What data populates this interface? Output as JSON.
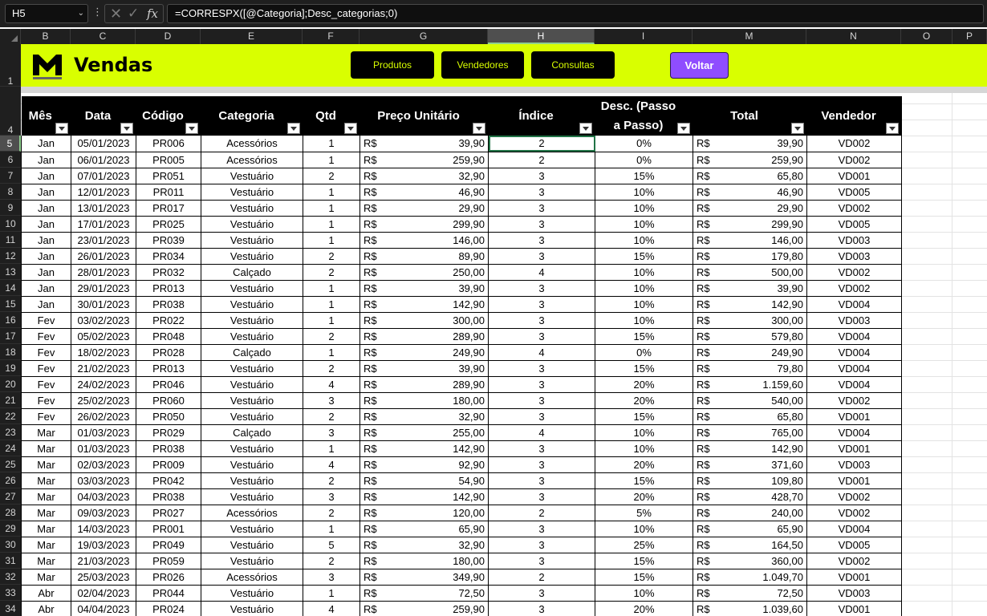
{
  "formula_bar": {
    "name_box": "H5",
    "cancel_icon": "close-icon",
    "enter_icon": "check-icon",
    "fx_label": "fx",
    "formula": "=CORRESPX([@Categoria];Desc_categorias;0)"
  },
  "columns": [
    "B",
    "C",
    "D",
    "E",
    "F",
    "G",
    "H",
    "I",
    "M",
    "N",
    "O",
    "P"
  ],
  "active_column": "H",
  "row_numbers": [
    "1",
    "4",
    "5",
    "6",
    "7",
    "8",
    "9",
    "10",
    "11",
    "12",
    "13",
    "14",
    "15",
    "16",
    "17",
    "18",
    "19",
    "20",
    "21",
    "22",
    "23",
    "24",
    "25",
    "26",
    "27",
    "28",
    "29",
    "30",
    "31",
    "32",
    "33",
    "34"
  ],
  "active_row": "5",
  "banner": {
    "title": "Vendas",
    "logo": "M",
    "buttons": [
      "Produtos",
      "Vendedores",
      "Consultas"
    ],
    "back_button": "Voltar",
    "background": "#d9ff00",
    "back_color": "#8f4dff"
  },
  "table": {
    "headers": [
      "Mês",
      "Data",
      "Código",
      "Categoria",
      "Qtd",
      "Preço Unitário",
      "Índice",
      "Desc. (Passo a Passo)",
      "Total",
      "Vendedor"
    ],
    "currency": "R$",
    "rows": [
      [
        "Jan",
        "05/01/2023",
        "PR006",
        "Acessórios",
        "1",
        "39,90",
        "2",
        "0%",
        "39,90",
        "VD002"
      ],
      [
        "Jan",
        "06/01/2023",
        "PR005",
        "Acessórios",
        "1",
        "259,90",
        "2",
        "0%",
        "259,90",
        "VD002"
      ],
      [
        "Jan",
        "07/01/2023",
        "PR051",
        "Vestuário",
        "2",
        "32,90",
        "3",
        "15%",
        "65,80",
        "VD001"
      ],
      [
        "Jan",
        "12/01/2023",
        "PR011",
        "Vestuário",
        "1",
        "46,90",
        "3",
        "10%",
        "46,90",
        "VD005"
      ],
      [
        "Jan",
        "13/01/2023",
        "PR017",
        "Vestuário",
        "1",
        "29,90",
        "3",
        "10%",
        "29,90",
        "VD002"
      ],
      [
        "Jan",
        "17/01/2023",
        "PR025",
        "Vestuário",
        "1",
        "299,90",
        "3",
        "10%",
        "299,90",
        "VD005"
      ],
      [
        "Jan",
        "23/01/2023",
        "PR039",
        "Vestuário",
        "1",
        "146,00",
        "3",
        "10%",
        "146,00",
        "VD003"
      ],
      [
        "Jan",
        "26/01/2023",
        "PR034",
        "Vestuário",
        "2",
        "89,90",
        "3",
        "15%",
        "179,80",
        "VD003"
      ],
      [
        "Jan",
        "28/01/2023",
        "PR032",
        "Calçado",
        "2",
        "250,00",
        "4",
        "10%",
        "500,00",
        "VD002"
      ],
      [
        "Jan",
        "29/01/2023",
        "PR013",
        "Vestuário",
        "1",
        "39,90",
        "3",
        "10%",
        "39,90",
        "VD002"
      ],
      [
        "Jan",
        "30/01/2023",
        "PR038",
        "Vestuário",
        "1",
        "142,90",
        "3",
        "10%",
        "142,90",
        "VD004"
      ],
      [
        "Fev",
        "03/02/2023",
        "PR022",
        "Vestuário",
        "1",
        "300,00",
        "3",
        "10%",
        "300,00",
        "VD003"
      ],
      [
        "Fev",
        "05/02/2023",
        "PR048",
        "Vestuário",
        "2",
        "289,90",
        "3",
        "15%",
        "579,80",
        "VD004"
      ],
      [
        "Fev",
        "18/02/2023",
        "PR028",
        "Calçado",
        "1",
        "249,90",
        "4",
        "0%",
        "249,90",
        "VD004"
      ],
      [
        "Fev",
        "21/02/2023",
        "PR013",
        "Vestuário",
        "2",
        "39,90",
        "3",
        "15%",
        "79,80",
        "VD004"
      ],
      [
        "Fev",
        "24/02/2023",
        "PR046",
        "Vestuário",
        "4",
        "289,90",
        "3",
        "20%",
        "1.159,60",
        "VD004"
      ],
      [
        "Fev",
        "25/02/2023",
        "PR060",
        "Vestuário",
        "3",
        "180,00",
        "3",
        "20%",
        "540,00",
        "VD002"
      ],
      [
        "Fev",
        "26/02/2023",
        "PR050",
        "Vestuário",
        "2",
        "32,90",
        "3",
        "15%",
        "65,80",
        "VD001"
      ],
      [
        "Mar",
        "01/03/2023",
        "PR029",
        "Calçado",
        "3",
        "255,00",
        "4",
        "10%",
        "765,00",
        "VD004"
      ],
      [
        "Mar",
        "01/03/2023",
        "PR038",
        "Vestuário",
        "1",
        "142,90",
        "3",
        "10%",
        "142,90",
        "VD001"
      ],
      [
        "Mar",
        "02/03/2023",
        "PR009",
        "Vestuário",
        "4",
        "92,90",
        "3",
        "20%",
        "371,60",
        "VD003"
      ],
      [
        "Mar",
        "03/03/2023",
        "PR042",
        "Vestuário",
        "2",
        "54,90",
        "3",
        "15%",
        "109,80",
        "VD001"
      ],
      [
        "Mar",
        "04/03/2023",
        "PR038",
        "Vestuário",
        "3",
        "142,90",
        "3",
        "20%",
        "428,70",
        "VD002"
      ],
      [
        "Mar",
        "09/03/2023",
        "PR027",
        "Acessórios",
        "2",
        "120,00",
        "2",
        "5%",
        "240,00",
        "VD002"
      ],
      [
        "Mar",
        "14/03/2023",
        "PR001",
        "Vestuário",
        "1",
        "65,90",
        "3",
        "10%",
        "65,90",
        "VD004"
      ],
      [
        "Mar",
        "19/03/2023",
        "PR049",
        "Vestuário",
        "5",
        "32,90",
        "3",
        "25%",
        "164,50",
        "VD005"
      ],
      [
        "Mar",
        "21/03/2023",
        "PR059",
        "Vestuário",
        "2",
        "180,00",
        "3",
        "15%",
        "360,00",
        "VD002"
      ],
      [
        "Mar",
        "25/03/2023",
        "PR026",
        "Acessórios",
        "3",
        "349,90",
        "2",
        "15%",
        "1.049,70",
        "VD001"
      ],
      [
        "Abr",
        "02/04/2023",
        "PR044",
        "Vestuário",
        "1",
        "72,50",
        "3",
        "10%",
        "72,50",
        "VD003"
      ],
      [
        "Abr",
        "04/04/2023",
        "PR024",
        "Vestuário",
        "4",
        "259,90",
        "3",
        "20%",
        "1.039,60",
        "VD001"
      ]
    ]
  }
}
